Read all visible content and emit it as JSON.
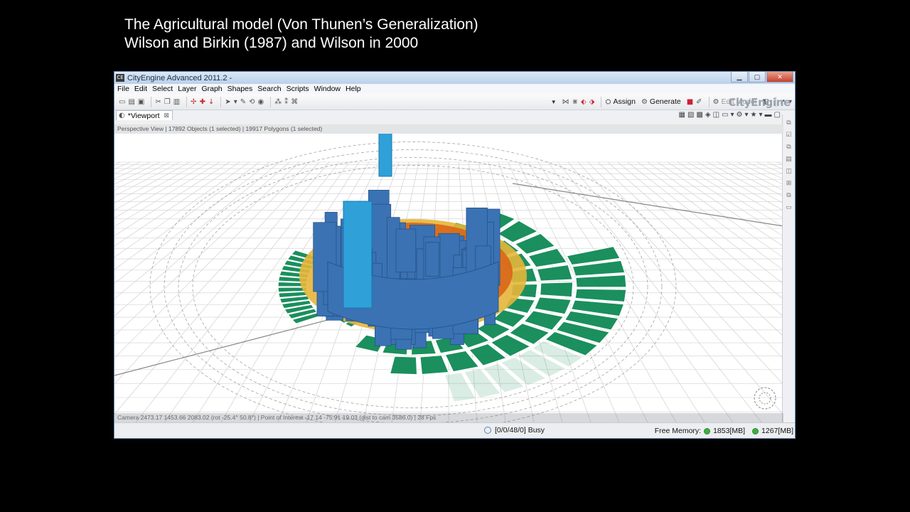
{
  "slide": {
    "title_line1": "The Agricultural model (Von Thunen’s Generalization)",
    "title_line2": "Wilson and Birkin (1987) and Wilson in 2000"
  },
  "window": {
    "title": "CityEngine Advanced 2011.2 -",
    "app_icon": "CE",
    "brand": "CityEngine"
  },
  "menu": [
    "File",
    "Edit",
    "Select",
    "Layer",
    "Graph",
    "Shapes",
    "Search",
    "Scripts",
    "Window",
    "Help"
  ],
  "toolbar": {
    "assign_label": "Assign",
    "generate_label": "Generate",
    "edit_model_label": "Edit Model"
  },
  "tab": {
    "label": "*Viewport",
    "close": "⊠"
  },
  "viewport": {
    "info": "Perspective View  |  17892 Objects  (1 selected)  |  19917 Polygons  (1 selected)",
    "camera": "Camera 2473.17 1453.66 2083.02  (rot -25.4° 50.8°)  |  Point of Interest -17.14 -75.91 19.03  (dist to cam 3586.0)  |  28 Fps"
  },
  "status": {
    "progress": "[0/0/48/0] Busy",
    "free_memory_label": "Free Memory:",
    "mem1": "1853[MB]",
    "mem2": "1267[MB]"
  },
  "colors": {
    "green_fields": "#0f8a55",
    "blue_buildings": "#3a72b4",
    "orange_buildings": "#d8661a",
    "yellow_buildings": "#e5b63a",
    "cyan_tower": "#2fa0d8"
  }
}
